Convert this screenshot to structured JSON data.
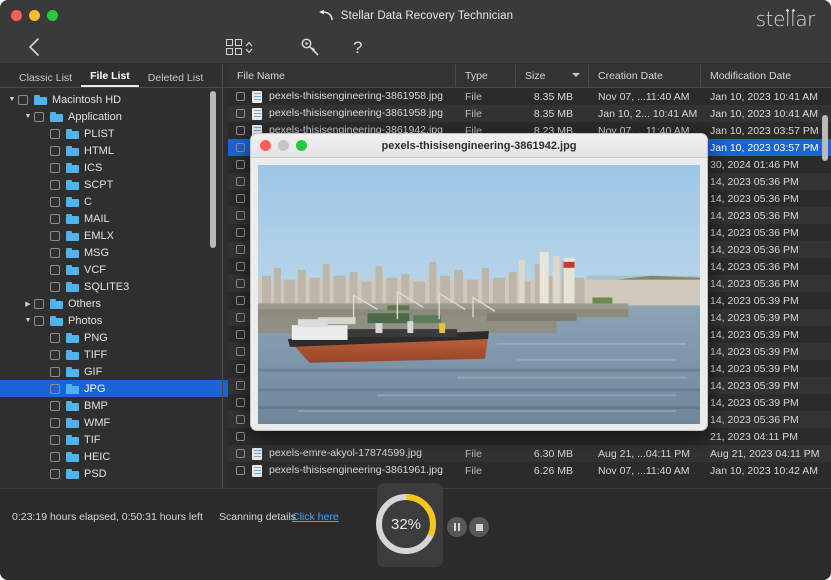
{
  "window": {
    "title": "Stellar Data Recovery Technician",
    "brand_part1": "ste",
    "brand_part2": "ll",
    "brand_part3": "ar",
    "traffic": [
      "close-button",
      "minimize-button",
      "zoom-button"
    ]
  },
  "toolbar": {
    "back_icon": "chevron-left-icon",
    "grid_icon": "grid-view-icon",
    "sort_icon": "sort-chevrons-icon",
    "settings_icon": "key-icon",
    "help_icon": "question-mark-icon"
  },
  "tabs": [
    {
      "label": "Classic List",
      "active": false
    },
    {
      "label": "File List",
      "active": true
    },
    {
      "label": "Deleted List",
      "active": false
    }
  ],
  "tree": [
    {
      "label": "Macintosh HD",
      "indent": 0,
      "twist": "down",
      "checkbox": true,
      "selected": false
    },
    {
      "label": "Application",
      "indent": 1,
      "twist": "down",
      "checkbox": true,
      "selected": false
    },
    {
      "label": "PLIST",
      "indent": 2,
      "twist": "none",
      "checkbox": true,
      "selected": false
    },
    {
      "label": "HTML",
      "indent": 2,
      "twist": "none",
      "checkbox": true,
      "selected": false
    },
    {
      "label": "ICS",
      "indent": 2,
      "twist": "none",
      "checkbox": true,
      "selected": false
    },
    {
      "label": "SCPT",
      "indent": 2,
      "twist": "none",
      "checkbox": true,
      "selected": false
    },
    {
      "label": "C",
      "indent": 2,
      "twist": "none",
      "checkbox": true,
      "selected": false
    },
    {
      "label": "MAIL",
      "indent": 2,
      "twist": "none",
      "checkbox": true,
      "selected": false
    },
    {
      "label": "EMLX",
      "indent": 2,
      "twist": "none",
      "checkbox": true,
      "selected": false
    },
    {
      "label": "MSG",
      "indent": 2,
      "twist": "none",
      "checkbox": true,
      "selected": false
    },
    {
      "label": "VCF",
      "indent": 2,
      "twist": "none",
      "checkbox": true,
      "selected": false
    },
    {
      "label": "SQLITE3",
      "indent": 2,
      "twist": "none",
      "checkbox": true,
      "selected": false
    },
    {
      "label": "Others",
      "indent": 1,
      "twist": "right",
      "checkbox": true,
      "selected": false
    },
    {
      "label": "Photos",
      "indent": 1,
      "twist": "down",
      "checkbox": true,
      "selected": false
    },
    {
      "label": "PNG",
      "indent": 2,
      "twist": "none",
      "checkbox": true,
      "selected": false
    },
    {
      "label": "TIFF",
      "indent": 2,
      "twist": "none",
      "checkbox": true,
      "selected": false
    },
    {
      "label": "GIF",
      "indent": 2,
      "twist": "none",
      "checkbox": true,
      "selected": false
    },
    {
      "label": "JPG",
      "indent": 2,
      "twist": "none",
      "checkbox": true,
      "selected": true
    },
    {
      "label": "BMP",
      "indent": 2,
      "twist": "none",
      "checkbox": true,
      "selected": false
    },
    {
      "label": "WMF",
      "indent": 2,
      "twist": "none",
      "checkbox": true,
      "selected": false
    },
    {
      "label": "TIF",
      "indent": 2,
      "twist": "none",
      "checkbox": true,
      "selected": false
    },
    {
      "label": "HEIC",
      "indent": 2,
      "twist": "none",
      "checkbox": true,
      "selected": false
    },
    {
      "label": "PSD",
      "indent": 2,
      "twist": "none",
      "checkbox": true,
      "selected": false
    }
  ],
  "columns": {
    "name": "File Name",
    "type": "Type",
    "size": "Size",
    "created": "Creation Date",
    "modified": "Modification Date"
  },
  "files": [
    {
      "name": "pexels-thisisengineering-3861958.jpg",
      "type": "File",
      "size": "8.35 MB",
      "created": "Nov 07, ...11:40 AM",
      "modified": "Jan 10, 2023 10:41 AM",
      "selected": false
    },
    {
      "name": "pexels-thisisengineering-3861958.jpg",
      "type": "File",
      "size": "8.35 MB",
      "created": "Jan 10, 2... 10:41 AM",
      "modified": "Jan 10, 2023 10:41 AM",
      "selected": false
    },
    {
      "name": "pexels-thisisengineering-3861942.jpg",
      "type": "File",
      "size": "8.23 MB",
      "created": "Nov 07, ...11:40 AM",
      "modified": "Jan 10, 2023 03:57 PM",
      "selected": false
    },
    {
      "name": "pexels-thisisengineering-3861942.jpg",
      "type": "File",
      "size": "8.23 MB",
      "created": "Jan 10, 2... 03:57 PM",
      "modified": "Jan 10, 2023 03:57 PM",
      "selected": true
    },
    {
      "name": "",
      "type": "",
      "size": "",
      "created": "",
      "modified": "30, 2024 01:46 PM",
      "selected": false
    },
    {
      "name": "",
      "type": "",
      "size": "",
      "created": "",
      "modified": "14, 2023 05:36 PM",
      "selected": false
    },
    {
      "name": "",
      "type": "",
      "size": "",
      "created": "",
      "modified": "14, 2023 05:36 PM",
      "selected": false
    },
    {
      "name": "",
      "type": "",
      "size": "",
      "created": "",
      "modified": "14, 2023 05:36 PM",
      "selected": false
    },
    {
      "name": "",
      "type": "",
      "size": "",
      "created": "",
      "modified": "14, 2023 05:36 PM",
      "selected": false
    },
    {
      "name": "",
      "type": "",
      "size": "",
      "created": "",
      "modified": "14, 2023 05:36 PM",
      "selected": false
    },
    {
      "name": "",
      "type": "",
      "size": "",
      "created": "",
      "modified": "14, 2023 05:36 PM",
      "selected": false
    },
    {
      "name": "",
      "type": "",
      "size": "",
      "created": "",
      "modified": "14, 2023 05:36 PM",
      "selected": false
    },
    {
      "name": "",
      "type": "",
      "size": "",
      "created": "",
      "modified": "14, 2023 05:39 PM",
      "selected": false
    },
    {
      "name": "",
      "type": "",
      "size": "",
      "created": "",
      "modified": "14, 2023 05:39 PM",
      "selected": false
    },
    {
      "name": "",
      "type": "",
      "size": "",
      "created": "",
      "modified": "14, 2023 05:39 PM",
      "selected": false
    },
    {
      "name": "",
      "type": "",
      "size": "",
      "created": "",
      "modified": "14, 2023 05:39 PM",
      "selected": false
    },
    {
      "name": "",
      "type": "",
      "size": "",
      "created": "",
      "modified": "14, 2023 05:39 PM",
      "selected": false
    },
    {
      "name": "",
      "type": "",
      "size": "",
      "created": "",
      "modified": "14, 2023 05:39 PM",
      "selected": false
    },
    {
      "name": "",
      "type": "",
      "size": "",
      "created": "",
      "modified": "14, 2023 05:39 PM",
      "selected": false
    },
    {
      "name": "",
      "type": "",
      "size": "",
      "created": "",
      "modified": "14, 2023 05:36 PM",
      "selected": false
    },
    {
      "name": "",
      "type": "",
      "size": "",
      "created": "",
      "modified": "21, 2023 04:11 PM",
      "selected": false
    },
    {
      "name": "pexels-emre-akyol-17874599.jpg",
      "type": "File",
      "size": "6.30 MB",
      "created": "Aug 21, ...04:11 PM",
      "modified": "Aug 21, 2023 04:11 PM",
      "selected": false
    },
    {
      "name": "pexels-thisisengineering-3861961.jpg",
      "type": "File",
      "size": "6.26 MB",
      "created": "Nov 07, ...11:40 AM",
      "modified": "Jan 10, 2023 10:42 AM",
      "selected": false
    }
  ],
  "preview": {
    "title": "pexels-thisisengineering-3861942.jpg",
    "image_description": "aerial-photo-port-city-cargo-ship"
  },
  "status": {
    "elapsed": "0:23:19 hours elapsed, 0:50:31 hours left",
    "scanning_label": "Scanning details",
    "link_label": "Click here",
    "progress_percent": "32%",
    "progress_value": 32,
    "pause_icon": "pause-icon",
    "stop_icon": "stop-icon"
  },
  "colors": {
    "accent_blue": "#1c63d5",
    "progress_yellow": "#f5c518",
    "progress_track": "#d6d6d6",
    "link_blue": "#4aa3ef",
    "folder_blue": "#4fb3f0"
  }
}
